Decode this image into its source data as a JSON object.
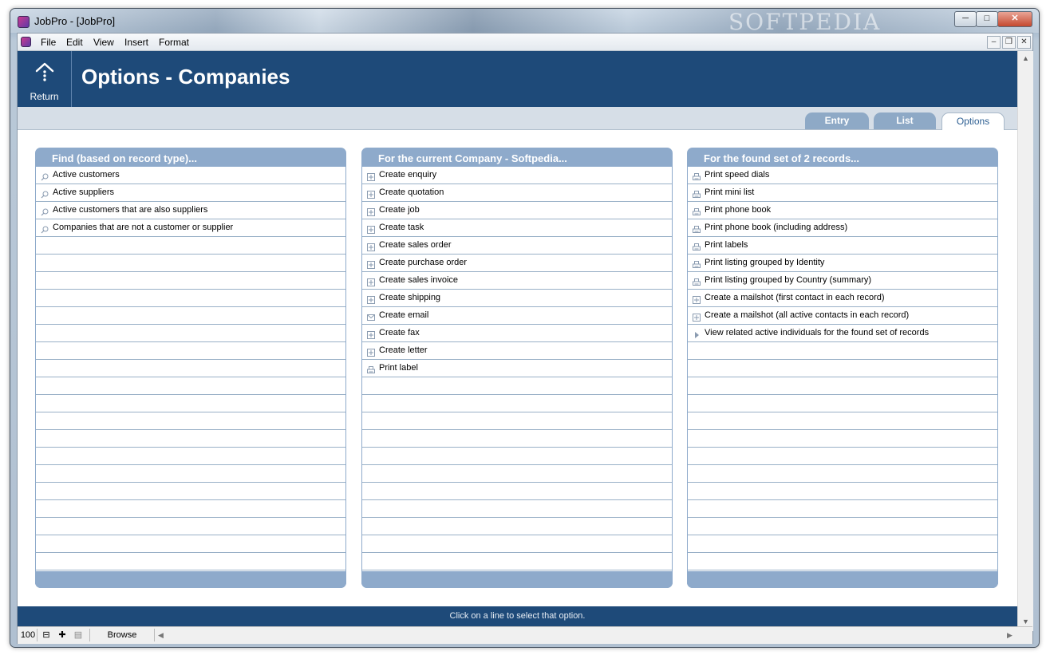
{
  "window": {
    "title": "JobPro - [JobPro]",
    "watermark": "SOFTPEDIA",
    "caption_buttons": [
      "minimize",
      "maximize",
      "close"
    ]
  },
  "menu": {
    "items": [
      "File",
      "Edit",
      "View",
      "Insert",
      "Format"
    ]
  },
  "header": {
    "return_label": "Return",
    "title": "Options - Companies",
    "background": "#1e4a79"
  },
  "tabs": [
    {
      "label": "Entry",
      "active": false
    },
    {
      "label": "List",
      "active": false
    },
    {
      "label": "Options",
      "active": true
    }
  ],
  "panels": [
    {
      "title": "Find (based on record type)...",
      "icon": "search-icon",
      "rows": [
        {
          "label": "Active customers",
          "icon": "search-icon"
        },
        {
          "label": "Active suppliers",
          "icon": "search-icon"
        },
        {
          "label": "Active customers that are also suppliers",
          "icon": "search-icon"
        },
        {
          "label": "Companies that are not a customer or supplier",
          "icon": "search-icon"
        }
      ]
    },
    {
      "title": "For the current Company - Softpedia...",
      "rows": [
        {
          "label": "Create enquiry",
          "icon": "plus-box-icon"
        },
        {
          "label": "Create quotation",
          "icon": "plus-box-icon"
        },
        {
          "label": "Create job",
          "icon": "plus-box-icon"
        },
        {
          "label": "Create task",
          "icon": "plus-box-icon"
        },
        {
          "label": "Create sales order",
          "icon": "plus-box-icon"
        },
        {
          "label": "Create purchase order",
          "icon": "plus-box-icon"
        },
        {
          "label": "Create sales invoice",
          "icon": "plus-box-icon"
        },
        {
          "label": "Create shipping",
          "icon": "plus-box-icon"
        },
        {
          "label": "Create email",
          "icon": "envelope-icon"
        },
        {
          "label": "Create fax",
          "icon": "plus-box-icon"
        },
        {
          "label": "Create letter",
          "icon": "plus-box-icon"
        },
        {
          "label": "Print label",
          "icon": "printer-icon"
        }
      ]
    },
    {
      "title": "For the found set of 2 records...",
      "rows": [
        {
          "label": "Print speed dials",
          "icon": "printer-icon"
        },
        {
          "label": "Print mini list",
          "icon": "printer-icon"
        },
        {
          "label": "Print phone book",
          "icon": "printer-icon"
        },
        {
          "label": "Print phone book (including address)",
          "icon": "printer-icon"
        },
        {
          "label": "Print labels",
          "icon": "printer-icon"
        },
        {
          "label": "Print listing grouped by Identity",
          "icon": "printer-icon"
        },
        {
          "label": "Print listing grouped by Country (summary)",
          "icon": "printer-icon"
        },
        {
          "label": "Create a mailshot (first contact in each record)",
          "icon": "plus-box-icon"
        },
        {
          "label": "Create a mailshot (all active contacts in each record)",
          "icon": "plus-box-icon"
        },
        {
          "label": "View related active individuals for the found set of records",
          "icon": "play-arrow-icon"
        }
      ]
    }
  ],
  "status": {
    "message": "Click on a line to select that option."
  },
  "bottombar": {
    "zoom": "100",
    "mode": "Browse"
  },
  "colors": {
    "panel_header": "#8eaacb",
    "row_border": "#99b0c7",
    "tab_inactive": "#8ea9c6"
  }
}
